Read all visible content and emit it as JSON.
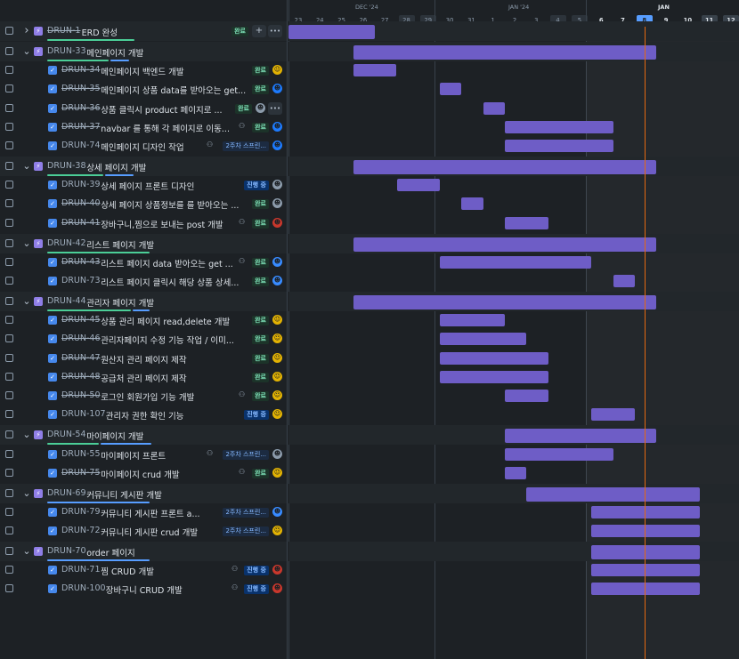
{
  "timeline": {
    "months": [
      {
        "label": "DEC '24",
        "current": false
      },
      {
        "label": "JAN '24",
        "current": false
      },
      {
        "label": "JAN",
        "current": true
      }
    ],
    "days": [
      {
        "d": "23",
        "wk": false
      },
      {
        "d": "24",
        "wk": false
      },
      {
        "d": "25",
        "wk": false
      },
      {
        "d": "26",
        "wk": false
      },
      {
        "d": "27",
        "wk": false
      },
      {
        "d": "28",
        "wk": true
      },
      {
        "d": "29",
        "wk": true
      },
      {
        "d": "30",
        "wk": false
      },
      {
        "d": "31",
        "wk": false
      },
      {
        "d": "1",
        "wk": false
      },
      {
        "d": "2",
        "wk": false
      },
      {
        "d": "3",
        "wk": false
      },
      {
        "d": "4",
        "wk": true
      },
      {
        "d": "5",
        "wk": true
      },
      {
        "d": "6",
        "wk": false,
        "now": true
      },
      {
        "d": "7",
        "wk": false,
        "now": true
      },
      {
        "d": "8",
        "wk": false,
        "today": true
      },
      {
        "d": "9",
        "wk": false,
        "now": true
      },
      {
        "d": "10",
        "wk": false,
        "now": true
      },
      {
        "d": "11",
        "wk": true,
        "now": true
      },
      {
        "d": "12",
        "wk": true,
        "now": true
      }
    ]
  },
  "rows": [
    {
      "type": "epic",
      "key": "DRUN-1",
      "done": true,
      "title": "ERD 완성",
      "expanded": false,
      "status": "완료",
      "actions": true,
      "bar": [
        0,
        4
      ],
      "green": 0.85,
      "blue": 0
    },
    {
      "type": "epic",
      "key": "DRUN-33",
      "done": false,
      "title": "메인페이지 개발",
      "expanded": true,
      "bar": [
        3,
        17
      ],
      "green": 0.6,
      "blue": 0.18
    },
    {
      "type": "task",
      "key": "DRUN-34",
      "done": true,
      "title": "메인페이지 백엔드 개발",
      "status": "완료",
      "avatar": "y",
      "bar": [
        3,
        5
      ]
    },
    {
      "type": "task",
      "key": "DRUN-35",
      "done": true,
      "title": "메인페이지 상품 data를 받아오는 get...",
      "status": "완료",
      "avatar": "t",
      "bar": [
        7,
        8
      ]
    },
    {
      "type": "task",
      "key": "DRUN-36",
      "done": true,
      "title": "상품 클릭시 product 페이지로 ...",
      "status": "완료",
      "avatar": "p",
      "more": true,
      "bar": [
        9,
        10
      ]
    },
    {
      "type": "task",
      "key": "DRUN-37",
      "done": true,
      "title": "navbar 를 통해 각 페이지로 이동...",
      "status": "완료",
      "avatar": "t",
      "child": true,
      "bar": [
        10,
        15
      ]
    },
    {
      "type": "task",
      "key": "DRUN-74",
      "done": false,
      "title": "메인페이지 디자인 작업",
      "sprint": "2주차 스프린...",
      "avatar": "t",
      "child": true,
      "bar": [
        10,
        15
      ]
    },
    {
      "type": "epic",
      "key": "DRUN-38",
      "done": false,
      "title": "상세 페이지 개발",
      "expanded": true,
      "bar": [
        3,
        17
      ],
      "green": 0.55,
      "blue": 0.28
    },
    {
      "type": "task",
      "key": "DRUN-39",
      "done": false,
      "title": "상세 페이지 프론트 디자인",
      "status": "진행 중",
      "statusType": "prog",
      "avatar": "p",
      "bar": [
        5,
        7
      ]
    },
    {
      "type": "task",
      "key": "DRUN-40",
      "done": true,
      "title": "상세 페이지 상품정보를 를 받아오는 ...",
      "status": "완료",
      "avatar": "p",
      "bar": [
        8,
        9
      ]
    },
    {
      "type": "task",
      "key": "DRUN-41",
      "done": true,
      "title": "장바구니,찜으로 보내는 post 개발",
      "status": "완료",
      "avatar": "r",
      "child": true,
      "bar": [
        10,
        12
      ]
    },
    {
      "type": "epic",
      "key": "DRUN-42",
      "done": false,
      "title": "리스트 페이지 개발",
      "expanded": true,
      "bar": [
        3,
        17
      ],
      "green": 1.0,
      "blue": 0
    },
    {
      "type": "task",
      "key": "DRUN-43",
      "done": true,
      "title": "리스트 페이지 data 받아오는 get ...",
      "status": "완료",
      "avatar": "b",
      "child": true,
      "bar": [
        7,
        14
      ]
    },
    {
      "type": "task",
      "key": "DRUN-73",
      "done": false,
      "title": "리스트 페이지 클릭시 해당 상품 상세...",
      "status": "완료",
      "avatar": "b",
      "bar": [
        15,
        16
      ]
    },
    {
      "type": "epic",
      "key": "DRUN-44",
      "done": false,
      "title": "관리자 페이지 개발",
      "expanded": true,
      "bar": [
        3,
        17
      ],
      "green": 0.82,
      "blue": 0.16
    },
    {
      "type": "task",
      "key": "DRUN-45",
      "done": true,
      "title": "상품 관리 페이지 read,delete 개발",
      "status": "완료",
      "avatar": "y",
      "bar": [
        7,
        10
      ]
    },
    {
      "type": "task",
      "key": "DRUN-46",
      "done": true,
      "title": "관리자페이지 수정 기능 작업 / 이미...",
      "status": "완료",
      "avatar": "y",
      "bar": [
        7,
        11
      ]
    },
    {
      "type": "task",
      "key": "DRUN-47",
      "done": true,
      "title": "원산지 관리 페이지 제작",
      "status": "완료",
      "avatar": "y",
      "bar": [
        7,
        12
      ]
    },
    {
      "type": "task",
      "key": "DRUN-48",
      "done": true,
      "title": "공급처 관리 페이지 제작",
      "status": "완료",
      "avatar": "y",
      "bar": [
        7,
        12
      ]
    },
    {
      "type": "task",
      "key": "DRUN-50",
      "done": true,
      "title": "로그인 회원가입 기능 개발",
      "status": "완료",
      "avatar": "y",
      "child": true,
      "bar": [
        10,
        12
      ]
    },
    {
      "type": "task",
      "key": "DRUN-107",
      "done": false,
      "title": "관리자 권한 확인 기능",
      "status": "진행 중",
      "statusType": "prog",
      "avatar": "y",
      "bar": [
        14,
        16
      ]
    },
    {
      "type": "epic",
      "key": "DRUN-54",
      "done": false,
      "title": "마이페이지 개발",
      "expanded": true,
      "bar": [
        10,
        17
      ],
      "green": 0.5,
      "blue": 0.5
    },
    {
      "type": "task",
      "key": "DRUN-55",
      "done": false,
      "title": "마이페이지 프론트",
      "sprint": "2주차 스프린...",
      "avatar": "p",
      "child": true,
      "bar": [
        10,
        15
      ]
    },
    {
      "type": "task",
      "key": "DRUN-75",
      "done": true,
      "title": "마이페이지 crud 개발",
      "status": "완료",
      "avatar": "y",
      "child": true,
      "bar": [
        10,
        11
      ]
    },
    {
      "type": "epic",
      "key": "DRUN-69",
      "done": false,
      "title": "커뮤니티 게시판 개발",
      "expanded": true,
      "bar": [
        11,
        19
      ],
      "green": 0,
      "blue": 1.0
    },
    {
      "type": "task",
      "key": "DRUN-79",
      "done": false,
      "title": "커뮤니티 게시판 프론트 a...",
      "sprint": "2주차 스프린...",
      "avatar": "b",
      "bar": [
        14,
        19
      ]
    },
    {
      "type": "task",
      "key": "DRUN-72",
      "done": false,
      "title": "커뮤니티 게시판 crud 개발",
      "sprint": "2주차 스프린...",
      "avatar": "y",
      "bar": [
        14,
        19
      ]
    },
    {
      "type": "epic",
      "key": "DRUN-70",
      "done": false,
      "title": "order 페이지",
      "expanded": true,
      "bar": [
        14,
        19
      ],
      "green": 0,
      "blue": 1.0
    },
    {
      "type": "task",
      "key": "DRUN-71",
      "done": false,
      "title": "찜 CRUD 개발",
      "status": "진행 중",
      "statusType": "prog",
      "avatar": "r",
      "child": true,
      "bar": [
        14,
        19
      ]
    },
    {
      "type": "task",
      "key": "DRUN-100",
      "done": false,
      "title": "장바구니 CRUD 개발",
      "status": "진행 중",
      "statusType": "prog",
      "avatar": "r",
      "child": true,
      "bar": [
        14,
        19
      ]
    }
  ],
  "icons": {
    "expand": "chevron-right-icon",
    "collapse": "chevron-down-icon",
    "add": "plus-icon",
    "more": "ellipsis-icon",
    "child": "child-issues-icon",
    "epic": "epic-lightning-icon",
    "task": "task-check-icon"
  },
  "colors": {
    "bar": "#6e5dc6",
    "today_line": "#e56910",
    "done_badge": "#1c3329",
    "progress_badge": "#09326c"
  }
}
